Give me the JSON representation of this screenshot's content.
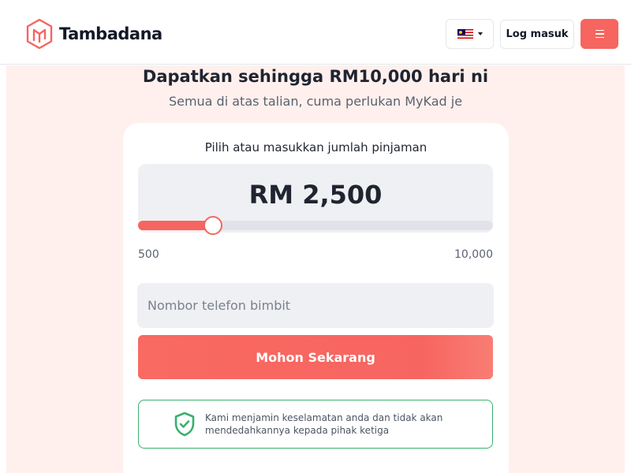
{
  "brand": {
    "name": "Tambadana",
    "accent_color": "#f6655f",
    "logo_icon": "tambadana-logo-icon"
  },
  "header": {
    "language_flag": "malaysia-flag-icon",
    "login_label": "Log masuk",
    "menu_icon": "hamburger-menu-icon"
  },
  "hero": {
    "headline": "Dapatkan sehingga RM10,000 hari ni",
    "subheadline": "Semua di atas talian, cuma perlukan MyKad je"
  },
  "loan_form": {
    "amount_label": "Pilih atau masukkan jumlah pinjaman",
    "amount_display": "RM 2,500",
    "amount_value": 2500,
    "slider_min": 500,
    "slider_max": 10000,
    "slider_min_label": "500",
    "slider_max_label": "10,000",
    "phone_placeholder": "Nombor telefon bimbit",
    "phone_value": "",
    "apply_label": "Mohon Sekarang"
  },
  "security_notice": {
    "icon": "shield-check-icon",
    "text": "Kami menjamin keselamatan anda dan tidak akan mendedahkannya kepada pihak ketiga",
    "color": "#3ab06d"
  }
}
